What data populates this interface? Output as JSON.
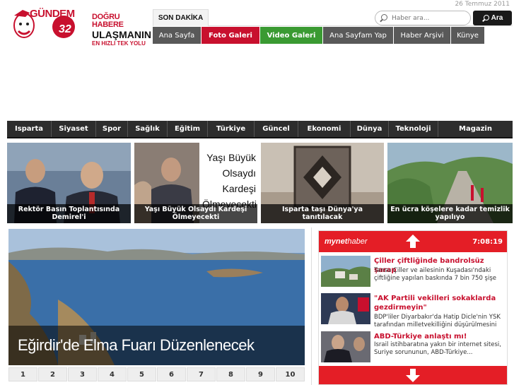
{
  "header": {
    "logo_text": "GÜNDEM",
    "logo_number": "32",
    "slogan_line1": "DOĞRU HABERE",
    "slogan_line2": "ULAŞMANIN",
    "slogan_line3": "EN HIZLI TEK YOLU",
    "date": "26 Temmuz 2011",
    "breaking_label": "SON DAKİKA"
  },
  "search": {
    "placeholder": "Haber ara...",
    "button_label": "Ara"
  },
  "top_nav": [
    {
      "label": "Ana Sayfa",
      "style": "dark"
    },
    {
      "label": "Foto Galeri",
      "style": "red"
    },
    {
      "label": "Video Galeri",
      "style": "green"
    },
    {
      "label": "Ana Sayfam Yap",
      "style": "dark"
    },
    {
      "label": "Haber Arşivi",
      "style": "dark"
    },
    {
      "label": "Künye",
      "style": "dark"
    }
  ],
  "categories": [
    "Isparta",
    "Siyaset",
    "Spor",
    "Sağlık",
    "Eğitim",
    "Türkiye",
    "Güncel",
    "Ekonomi",
    "Dünya",
    "Teknoloji",
    "Magazin"
  ],
  "features": [
    {
      "caption": "Rektör Basın Toplantısında Demirel'i"
    },
    {
      "caption": "Yaşı Büyük Olsaydı Kardeşi Ölmeyecekti",
      "overlay_text": "Yaşı Büyük Olsaydı Kardeşi Ölmeyecekti"
    },
    {
      "caption": "Isparta taşı Dünya'ya tanıtılacak"
    },
    {
      "caption": "En ücra köşelere kadar temizlik yapılıyo"
    }
  ],
  "slider": {
    "headline": "Eğirdir'de Elma Fuarı Düzenlenecek",
    "pages": [
      "1",
      "2",
      "3",
      "4",
      "5",
      "6",
      "7",
      "8",
      "9",
      "10"
    ]
  },
  "mynet": {
    "brand_prefix": "mynet",
    "brand_suffix": "haber",
    "time": "7:08:19",
    "items": [
      {
        "title": "Çiller çiftliğinde bandrolsüz şarap",
        "desc": "Tansu Çiller ve ailesinin Kuşadası'ndaki çiftliğine yapılan baskında 7 bin 750 şişe"
      },
      {
        "title": "\"AK Partili vekilleri sokaklarda gezdirmeyin\"",
        "desc": "BDP'liler Diyarbakır'da Hatip Dicle'nin YSK tarafından milletvekilliğini düşürülmesini"
      },
      {
        "title": "ABD-Türkiye anlaştı mı!",
        "desc": "İsrail istihbaratına yakın bir internet sitesi, Suriye sorununun, ABD-Türkiye..."
      }
    ]
  }
}
